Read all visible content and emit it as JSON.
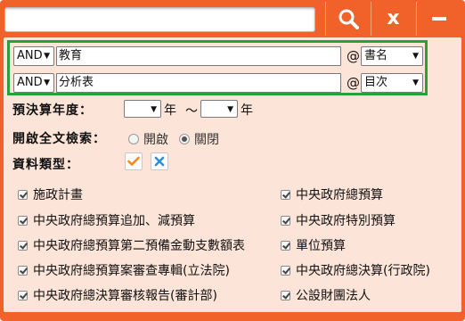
{
  "topbar": {
    "search_value": "",
    "buttons": [
      {
        "name": "search",
        "icon": "search-icon"
      },
      {
        "name": "close",
        "label": "x",
        "icon": "close-icon"
      },
      {
        "name": "minimize",
        "icon": "minimize-icon"
      }
    ]
  },
  "conditions": [
    {
      "operator": "AND",
      "keyword": "教育",
      "at": "@",
      "field": "書名"
    },
    {
      "operator": "AND",
      "keyword": "分析表",
      "at": "@",
      "field": "目次"
    }
  ],
  "year": {
    "label": "預決算年度：",
    "start": "",
    "end": "",
    "unit": "年",
    "tilde": "～"
  },
  "fulltext": {
    "label": "開啟全文檢索：",
    "options": [
      {
        "label": "開啟",
        "checked": false
      },
      {
        "label": "關閉",
        "checked": true
      }
    ]
  },
  "data_type": {
    "label": "資料類型：",
    "select_all_icon": "check-icon",
    "clear_all_icon": "x-icon"
  },
  "types": [
    {
      "label": "施政計畫",
      "checked": true
    },
    {
      "label": "中央政府總預算",
      "checked": true
    },
    {
      "label": "中央政府總預算追加、減預算",
      "checked": true
    },
    {
      "label": "中央政府特別預算",
      "checked": true
    },
    {
      "label": "中央政府總預算第二預備金動支數額表",
      "checked": true
    },
    {
      "label": "單位預算",
      "checked": true
    },
    {
      "label": "中央政府總預算案審查專輯(立法院)",
      "checked": true
    },
    {
      "label": "中央政府總決算(行政院)",
      "checked": true
    },
    {
      "label": "中央政府總決算審核報告(審計部)",
      "checked": true
    },
    {
      "label": "公設財團法人",
      "checked": true
    }
  ],
  "colors": {
    "frame": "#f0622a",
    "panel": "#fde4d9",
    "highlight_border": "#27a336",
    "check_accent": "#f08a1c",
    "x_accent": "#2f8fd6"
  }
}
